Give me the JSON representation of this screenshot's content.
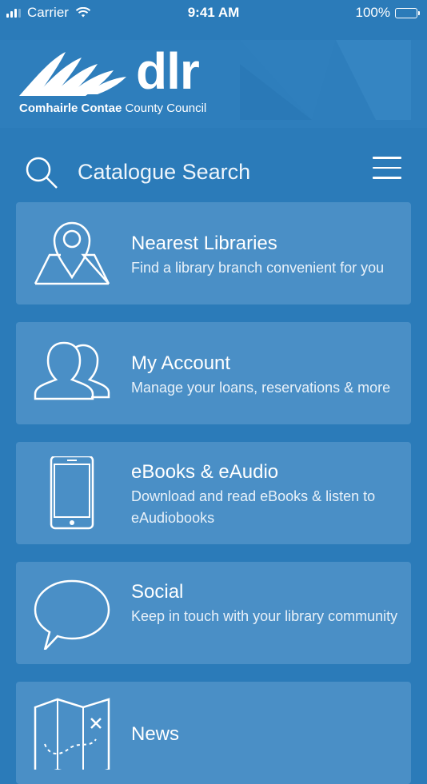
{
  "status_bar": {
    "carrier": "Carrier",
    "time": "9:41 AM",
    "battery": "100%"
  },
  "header": {
    "logo_word": "dlr",
    "logo_subtitle_bold": "Comhairle Contae",
    "logo_subtitle": " County Council"
  },
  "search": {
    "label": "Catalogue Search"
  },
  "cards": [
    {
      "title": "Nearest Libraries",
      "description": "Find a library branch convenient for you",
      "icon": "map-pin-icon"
    },
    {
      "title": "My Account",
      "description": "Manage your loans, reservations & more",
      "icon": "users-icon"
    },
    {
      "title": "eBooks & eAudio",
      "description": "Download and read eBooks & listen to eAudiobooks",
      "icon": "phone-icon"
    },
    {
      "title": "Social",
      "description": "Keep in touch with your library community",
      "icon": "speech-bubble-icon"
    },
    {
      "title": "News",
      "description": "",
      "icon": "treasure-map-icon"
    }
  ],
  "colors": {
    "background": "#2b7bb9",
    "card": "#4a8fc6",
    "text": "#ffffff"
  }
}
